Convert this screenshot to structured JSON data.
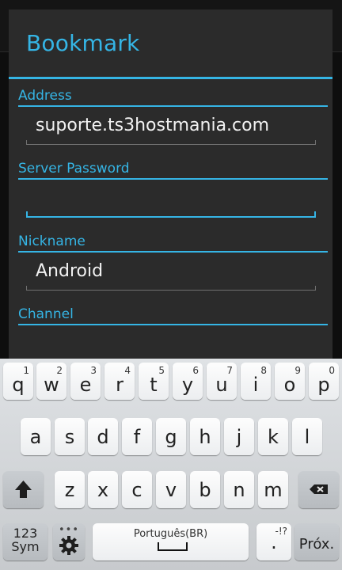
{
  "dialog": {
    "title": "Bookmark",
    "fields": [
      {
        "label": "Address",
        "value": "suporte.ts3hostmania.com"
      },
      {
        "label": "Server Password",
        "value": ""
      },
      {
        "label": "Nickname",
        "value": "Android"
      },
      {
        "label": "Channel",
        "value": ""
      }
    ]
  },
  "keyboard": {
    "row1": [
      {
        "key": "q",
        "hint": "1"
      },
      {
        "key": "w",
        "hint": "2"
      },
      {
        "key": "e",
        "hint": "3"
      },
      {
        "key": "r",
        "hint": "4"
      },
      {
        "key": "t",
        "hint": "5"
      },
      {
        "key": "y",
        "hint": "6"
      },
      {
        "key": "u",
        "hint": "7"
      },
      {
        "key": "i",
        "hint": "8"
      },
      {
        "key": "o",
        "hint": "9"
      },
      {
        "key": "p",
        "hint": "0"
      }
    ],
    "row2": [
      "a",
      "s",
      "d",
      "f",
      "g",
      "h",
      "j",
      "k",
      "l"
    ],
    "row3": [
      "z",
      "x",
      "c",
      "v",
      "b",
      "n",
      "m"
    ],
    "symbols_line1": "123",
    "symbols_line2": "Sym",
    "settings_hint": "•••",
    "space_language": "Português(BR)",
    "period": ".",
    "period_hint": "-!?",
    "action": "Próx."
  },
  "colors": {
    "accent": "#35b5e5",
    "dialog_bg": "#2b2b2b",
    "keyboard_bg": "#d5d8db"
  }
}
